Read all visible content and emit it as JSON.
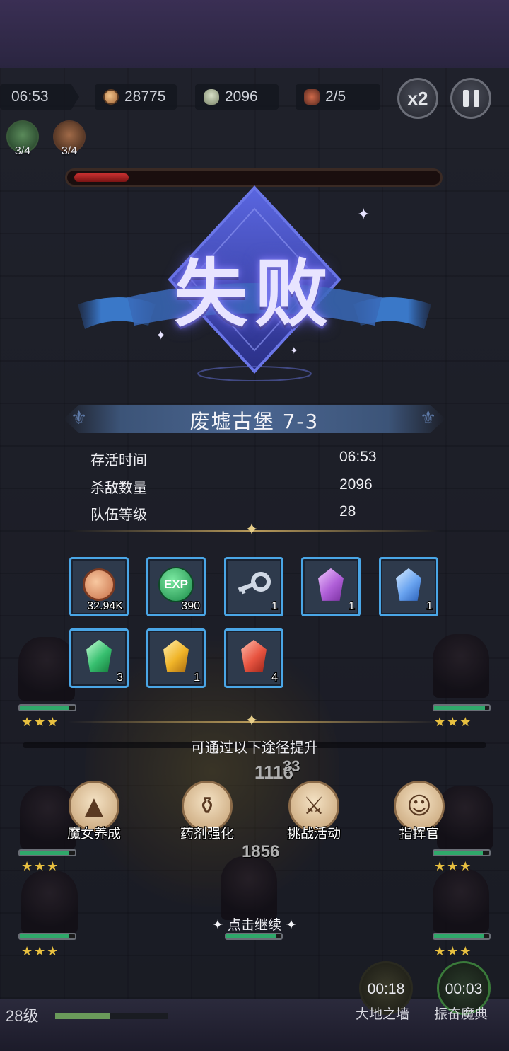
{
  "hud": {
    "timer": "06:53",
    "coins": "28775",
    "kills": "2096",
    "wave": "2/5",
    "speed_label": "x2",
    "buffs": [
      {
        "count": "3/4",
        "icon": "wind-blade-icon"
      },
      {
        "count": "3/4",
        "icon": "vortex-icon"
      }
    ],
    "boss_hp_fraction": 0.15
  },
  "result": {
    "title": "失败"
  },
  "stage": {
    "name": "废墟古堡 7-3"
  },
  "stats": [
    {
      "label": "存活时间",
      "value": "06:53"
    },
    {
      "label": "杀敌数量",
      "value": "2096"
    },
    {
      "label": "队伍等级",
      "value": "28"
    }
  ],
  "rewards": [
    {
      "name": "coin",
      "qty": "32.94K",
      "color": "#e8a070"
    },
    {
      "name": "exp",
      "qty": "390",
      "label": "EXP",
      "color": "#2fa860"
    },
    {
      "name": "key",
      "qty": "1",
      "color": "#b8c4d4"
    },
    {
      "name": "purple-crystal",
      "qty": "1",
      "color": "#c87ae0"
    },
    {
      "name": "blue-crystal",
      "qty": "1",
      "color": "#7ab0f0"
    },
    {
      "name": "green-crystal",
      "qty": "3",
      "color": "#3cc870"
    },
    {
      "name": "yellow-crystal",
      "qty": "1",
      "color": "#f0b428"
    },
    {
      "name": "red-crystal",
      "qty": "4",
      "color": "#e85440"
    }
  ],
  "improve": {
    "title": "可通过以下途径提升",
    "ways": [
      {
        "label": "魔女养成",
        "icon": "witch-hat-icon"
      },
      {
        "label": "药剂强化",
        "icon": "potion-icon"
      },
      {
        "label": "挑战活动",
        "icon": "crossed-swords-icon"
      },
      {
        "label": "指挥官",
        "icon": "commander-icon"
      }
    ]
  },
  "tap_to_continue": "点击继续",
  "battle": {
    "damage_numbers": [
      "1116",
      "33",
      "1856"
    ]
  },
  "bottom": {
    "level": "28级",
    "level_fraction": 0.48,
    "skills": [
      {
        "name": "大地之墙",
        "timer": "00:18"
      },
      {
        "name": "振奋魔典",
        "timer": "00:03"
      }
    ]
  },
  "colors": {
    "reward_border": "#4aa6e6",
    "title_glow": "#8b86ff",
    "boss_hp": "#c83030"
  }
}
